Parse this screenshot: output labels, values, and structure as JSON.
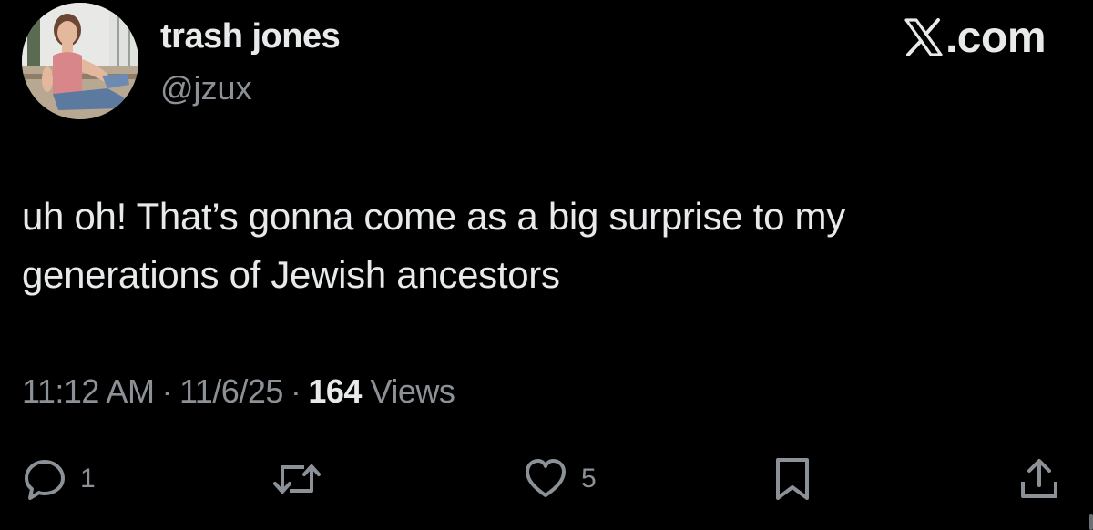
{
  "header": {
    "display_name": "trash jones",
    "handle": "@jzux",
    "brand": ".com"
  },
  "tweet": {
    "text_line1": "uh oh! That’s gonna come as a big surprise to my",
    "text_line2": "generations of Jewish ancestors"
  },
  "meta": {
    "time": "11:12 AM",
    "separator": "·",
    "date": "11/6/25",
    "views_count": "164",
    "views_label": "Views"
  },
  "actions": {
    "reply_count": "1",
    "like_count": "5"
  },
  "colors": {
    "background": "#000000",
    "primary_text": "#e7e9ea",
    "secondary_text": "#8b9197"
  },
  "icons": {
    "reply": "reply-icon",
    "retweet": "retweet-icon",
    "like": "heart-icon",
    "bookmark": "bookmark-icon",
    "share": "share-icon",
    "brand": "x-logo-icon"
  }
}
